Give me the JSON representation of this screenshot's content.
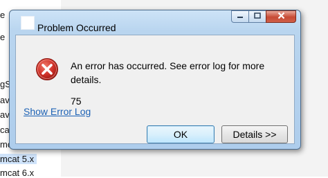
{
  "background": {
    "sidebar_items": [
      "e",
      "",
      "e",
      "gSo",
      "ava",
      "ava",
      "cat",
      "mcat",
      "mcat  5.x",
      "mcat  6.x"
    ]
  },
  "dialog": {
    "title": "Problem Occurred",
    "message": "An error has occurred. See error log for more details.",
    "code": "75",
    "link_label": "Show Error Log",
    "ok_label": "OK",
    "details_label": "Details >>",
    "controls": {
      "minimize_glyph": "▭",
      "maximize_glyph": "▢",
      "close_glyph": "✕"
    },
    "colors": {
      "error_red": "#c9302c",
      "link_blue": "#1d62b5"
    }
  }
}
